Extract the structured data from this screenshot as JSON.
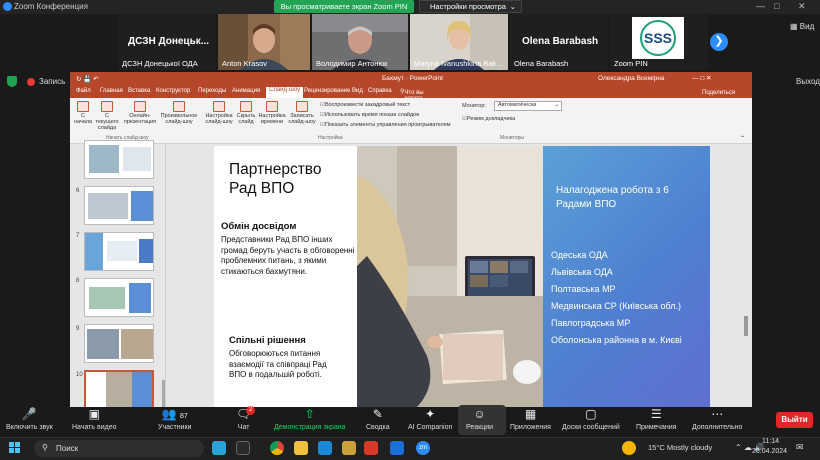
{
  "zoom": {
    "window_title": "Zoom Конференция",
    "share_banner": "Вы просматриваете экран Zoom PIN",
    "view_options": "Настройки просмотра",
    "view_label": "Вид",
    "record_label": "Запись",
    "exit_label": "Выход"
  },
  "participants": [
    {
      "name": "ДСЗН Донецької ОДА",
      "display": "ДСЗН  Донецьк..."
    },
    {
      "name": "Anton Krasov"
    },
    {
      "name": "Володимир Антонюк"
    },
    {
      "name": "Maryna Ivanushkina Bak..."
    },
    {
      "name": "Olena Barabash",
      "display": "Olena Barabash"
    },
    {
      "name": "Zoom PIN"
    }
  ],
  "powerpoint": {
    "title": "Бахмут · PowerPoint",
    "user": "Олександра Всемірна",
    "menu": [
      "Файл",
      "Главная",
      "Вставка",
      "Конструктор",
      "Переходы",
      "Анимация",
      "Слайд-шоу",
      "Рецензирование",
      "Вид",
      "Справка",
      "Что вы хотите сделать?"
    ],
    "active_menu": "Слайд-шоу",
    "share_label": "Поделиться",
    "ribbon": {
      "from_start": "С начала",
      "from_current": "С текущего слайда",
      "online": "Онлайн-презентация",
      "custom": "Произвольное слайд-шоу",
      "setup": "Настройка слайд-шоу",
      "hide": "Скрыть слайд",
      "rehearse": "Настройка времени",
      "record": "Записать слайд-шоу",
      "group_start": "Начать слайд-шоу",
      "group_setup": "Настройка",
      "group_monitors": "Мониторы",
      "chk_narration": "Воспроизвести закадровый текст",
      "chk_timings": "Использовать время показа слайдов",
      "chk_controls": "Показать элементы управления проигрывателем",
      "monitor_label": "Монитор:",
      "monitor_value": "Автоматически",
      "presenter_view": "Режим докладчика"
    },
    "thumbnails": [
      "6",
      "7",
      "8",
      "9",
      "10"
    ],
    "slide": {
      "title": "Партнерство Рад ВПО",
      "section1_head": "Обмін досвідом",
      "section1_body": "Представники Рад ВПО інших громад беруть участь в обговоренні проблемних питань, з якими стикаються бахмутяни.",
      "section2_head": "Спільні рішення",
      "section2_body": "Обговорюються питання взаємодії та співпраці Рад ВПО в подальшій роботі.",
      "right_title": "Налагоджена робота з 6 Радами ВПО",
      "councils": [
        "Одеська ОДА",
        "Львівська ОДА",
        "Полтавська МР",
        "Медвинська СР (Київська обл.)",
        "Павлоградська МР",
        "Оболонська районна в м. Києві"
      ]
    }
  },
  "toolbar": {
    "unmute": "Включить звук",
    "video": "Начать видео",
    "participants": "Участники",
    "participants_count": "87",
    "chat": "Чат",
    "chat_badge": "2",
    "share": "Демонстрация экрана",
    "summary": "Сводка",
    "companion": "AI Companion",
    "reactions": "Реакции",
    "apps": "Приложения",
    "whiteboards": "Доски сообщений",
    "notes": "Примечания",
    "more": "Дополнительно",
    "exit": "Выйти"
  },
  "taskbar": {
    "search": "Поиск",
    "weather": "15°C  Mostly cloudy",
    "time": "11:14",
    "date": "26.04.2024"
  },
  "colors": {
    "ppt_accent": "#b7472a",
    "zoom_blue": "#2d8cff",
    "zoom_green": "#23a455",
    "exit_red": "#e02828"
  }
}
